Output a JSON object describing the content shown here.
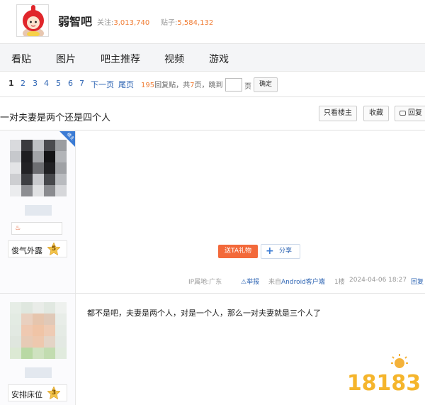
{
  "forum": {
    "name": "弱智吧",
    "followers_label": "关注:",
    "followers": "3,013,740",
    "posts_label": "贴子:",
    "posts": "5,584,132"
  },
  "nav": {
    "items": [
      "看贴",
      "图片",
      "吧主推荐",
      "视频",
      "游戏"
    ]
  },
  "pager": {
    "current": "1",
    "pages": [
      "2",
      "3",
      "4",
      "5",
      "6",
      "7"
    ],
    "next": "下一页",
    "last": "尾页",
    "reply_count": "195",
    "reply_label": "回复贴，共",
    "page_count": "7",
    "page_unit": "页，",
    "jump_label": "跳到",
    "jump_unit": "页",
    "confirm": "确定"
  },
  "thread": {
    "title": "一对夫妻是两个还是四个人",
    "only_op": "只看楼主",
    "favorite": "收藏",
    "reply": "回复"
  },
  "posts": [
    {
      "badge_corner": "楼主",
      "username": "俊气外露",
      "level": "5",
      "gift_label": "送TA礼物",
      "share_label": "分享",
      "ip_label": "IP属地:广东",
      "report_label": "举报",
      "source": "来自Android客户端",
      "floor": "1楼",
      "time": "2024-04-06 18:27",
      "reply_label": "回复"
    },
    {
      "username": "安排床位",
      "level": "3",
      "content": "都不是吧，夫妻是两个人，对是一个人，那么一对夫妻就是三个人了"
    }
  ],
  "watermark": {
    "text": "18183"
  },
  "colors": {
    "accent_orange": "#f07d35",
    "link_blue": "#2d64b3",
    "gift_red": "#f3693a",
    "nav_bg": "#f4f5f7"
  }
}
